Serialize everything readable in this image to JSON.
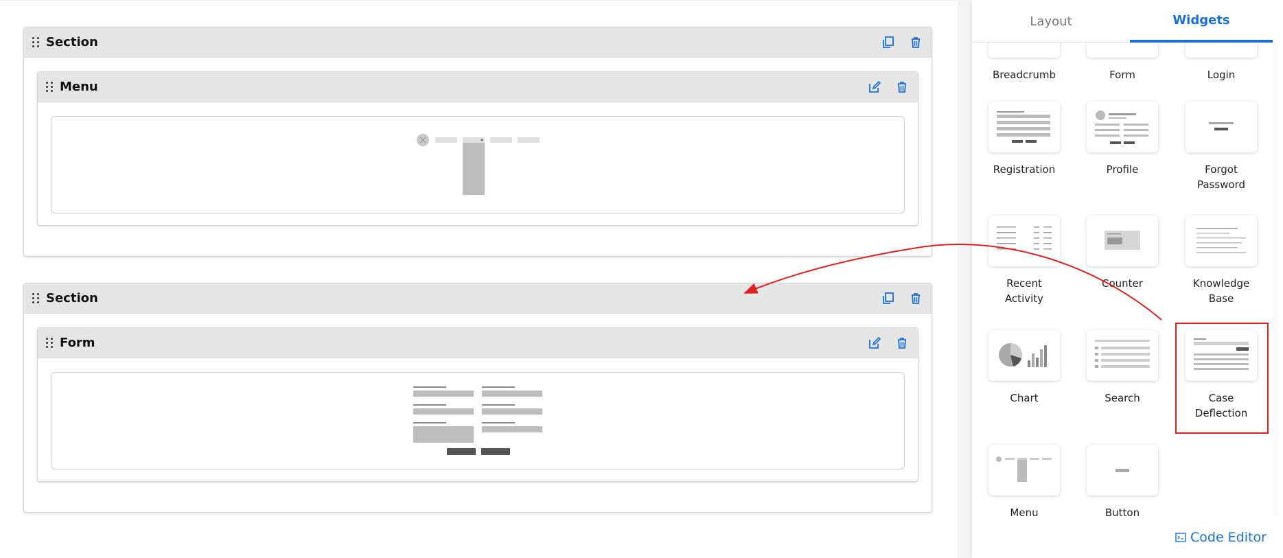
{
  "sections": [
    {
      "title": "Section",
      "widget": {
        "title": "Menu"
      }
    },
    {
      "title": "Section",
      "widget": {
        "title": "Form"
      }
    }
  ],
  "panel": {
    "tabs": {
      "layout": "Layout",
      "widgets": "Widgets"
    },
    "tiles": [
      {
        "label": "Breadcrumb",
        "icon": "breadcrumb-thumbnail"
      },
      {
        "label": "Form",
        "icon": "form-thumbnail"
      },
      {
        "label": "Login",
        "icon": "login-thumbnail"
      },
      {
        "label": "Registration",
        "icon": "registration-thumbnail"
      },
      {
        "label": "Profile",
        "icon": "profile-thumbnail"
      },
      {
        "label": "Forgot Password",
        "icon": "forgot-password-thumbnail"
      },
      {
        "label": "Recent Activity",
        "icon": "recent-activity-thumbnail"
      },
      {
        "label": "Counter",
        "icon": "counter-thumbnail"
      },
      {
        "label": "Knowledge Base",
        "icon": "knowledge-base-thumbnail"
      },
      {
        "label": "Chart",
        "icon": "chart-thumbnail"
      },
      {
        "label": "Search",
        "icon": "search-thumbnail"
      },
      {
        "label": "Case Deflection",
        "icon": "case-deflection-thumbnail"
      },
      {
        "label": "Menu",
        "icon": "menu-thumbnail"
      },
      {
        "label": "Button",
        "icon": "button-thumbnail"
      }
    ],
    "code_editor": "Code Editor"
  },
  "colors": {
    "accent": "#1a6fd8",
    "annotation": "#e02020",
    "header_bg": "#e6e6e6"
  }
}
